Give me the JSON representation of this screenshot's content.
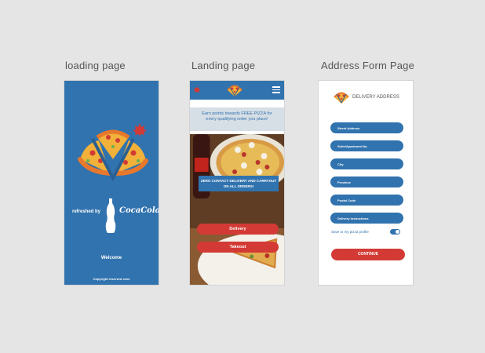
{
  "captions": {
    "loading": "loading page",
    "landing": "Landing page",
    "address": "Address Form Page"
  },
  "loading_page": {
    "refreshed_by": "refreshed by",
    "brand": "CocaCola",
    "welcome": "Welcome",
    "copyright": "Copyright reserved xxxx"
  },
  "landing_page": {
    "promo": "Earn points towards FREE PIZZA for every qualifying order you place!",
    "banner": "ZERO CONTACT DELIVERY AND CARRYOUT ON ALL ORDERS!",
    "delivery_label": "Delivery",
    "takeout_label": "Takeout"
  },
  "address_page": {
    "title": "DELIVERY ADDRESS",
    "fields": {
      "street": "Street Address",
      "suite": "Suite/Apartment No.",
      "city": "City",
      "province": "Province",
      "postal": "Postal Code",
      "instructions": "Delivery Instructions"
    },
    "save_label": "Save to my pizza profile",
    "continue_label": "CONTINUE"
  },
  "colors": {
    "primary_blue": "#3173ae",
    "accent_red": "#d33a35",
    "background": "#e5e5e5"
  }
}
